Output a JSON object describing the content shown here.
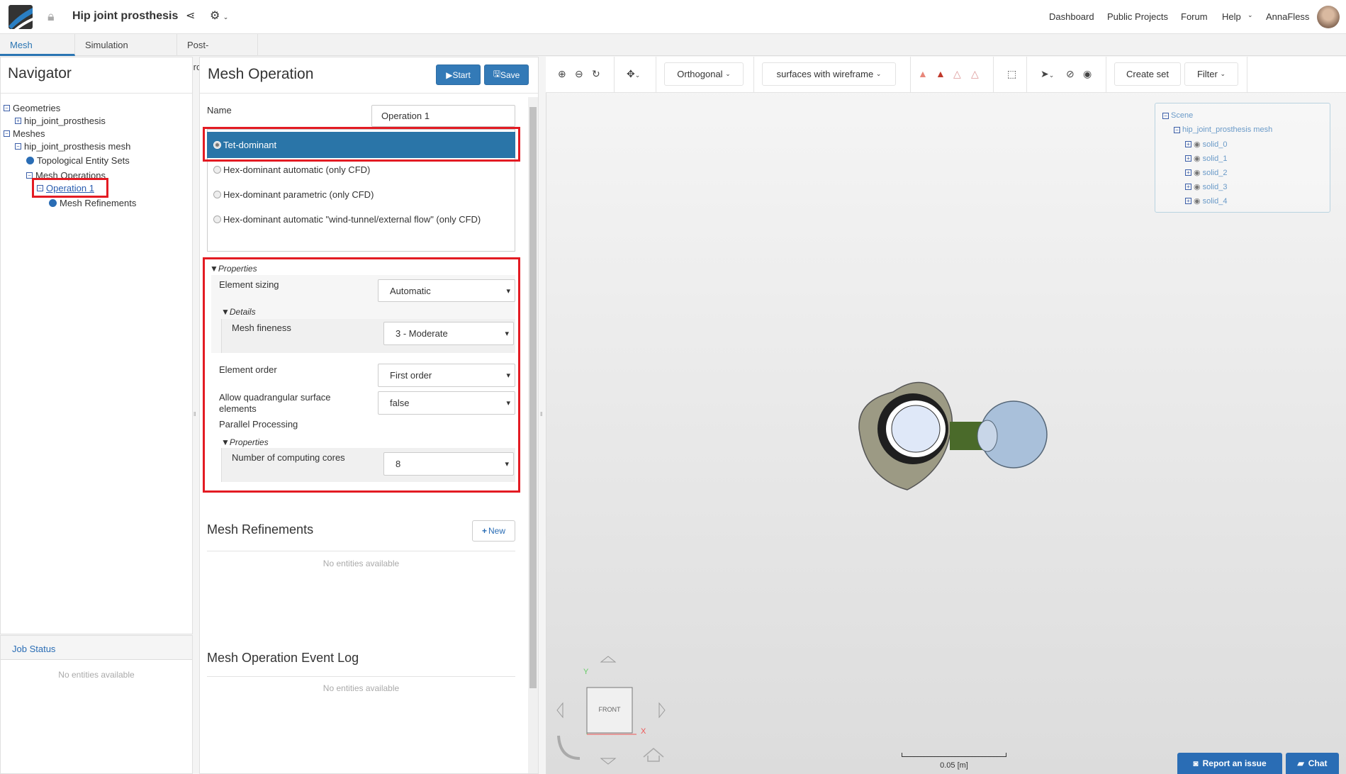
{
  "header": {
    "project_title": "Hip joint prosthesis",
    "nav": [
      "Dashboard",
      "Public Projects",
      "Forum",
      "Help"
    ],
    "user": "AnnaFless"
  },
  "tabs": [
    "Mesh Creator",
    "Simulation Designer",
    "Post-Processor"
  ],
  "navigator": {
    "title": "Navigator",
    "tree": [
      "Geometries",
      "hip_joint_prosthesis",
      "Meshes",
      "hip_joint_prosthesis mesh",
      "Topological Entity Sets",
      "Mesh Operations",
      "Operation 1",
      "Mesh Refinements"
    ]
  },
  "job_status": {
    "title": "Job Status",
    "empty": "No entities available"
  },
  "mesh_operation": {
    "title": "Mesh Operation",
    "start": "Start",
    "save": "Save",
    "name_label": "Name",
    "name_value": "Operation 1",
    "types": [
      "Tet-dominant",
      "Hex-dominant automatic (only CFD)",
      "Hex-dominant parametric (only CFD)",
      "Hex-dominant automatic \"wind-tunnel/external flow\" (only CFD)"
    ],
    "selected_type": "Tet-dominant",
    "properties": {
      "header": "Properties",
      "element_sizing_label": "Element sizing",
      "element_sizing": "Automatic",
      "details": "Details",
      "mesh_fineness_label": "Mesh fineness",
      "mesh_fineness": "3 - Moderate",
      "element_order_label": "Element order",
      "element_order": "First order",
      "quad_label": "Allow quadrangular surface elements",
      "quad_value": "false",
      "parallel_label": "Parallel Processing",
      "sub_properties": "Properties",
      "cores_label": "Number of computing cores",
      "cores": "8"
    }
  },
  "mesh_refinements": {
    "title": "Mesh Refinements",
    "new": "New",
    "empty": "No entities available"
  },
  "event_log": {
    "title": "Mesh Operation Event Log",
    "empty": "No entities available"
  },
  "viewer": {
    "projection": "Orthogonal",
    "render_mode": "surfaces with wireframe",
    "create_set": "Create set",
    "filter": "Filter",
    "scene_tree": {
      "root": "Scene",
      "mesh": "hip_joint_prosthesis mesh",
      "solids": [
        "solid_0",
        "solid_1",
        "solid_2",
        "solid_3",
        "solid_4"
      ]
    },
    "cube_face": "FRONT",
    "axis_x": "X",
    "axis_y": "Y",
    "scale": "0.05 [m]"
  },
  "footer": {
    "report": "Report an issue",
    "chat": "Chat"
  },
  "colors": {
    "accent": "#337ab7",
    "highlight": "#e31b23",
    "selected_row": "#2a75a8"
  }
}
